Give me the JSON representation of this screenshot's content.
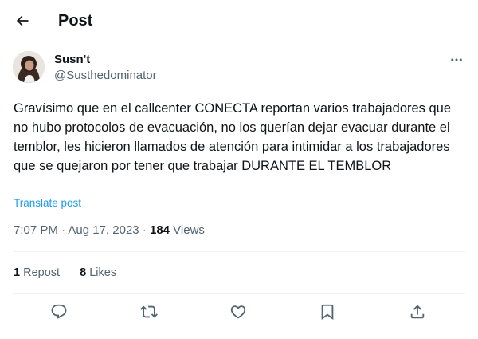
{
  "header": {
    "title": "Post",
    "back_icon": "arrow-left-icon"
  },
  "author": {
    "display_name": "Susn't",
    "handle": "@Susthedominator"
  },
  "menu": {
    "icon": "more-horizontal-icon"
  },
  "post": {
    "text": "Gravísimo que en el callcenter CONECTA reportan varios trabajadores que no hubo protocolos de evacuación, no los querían dejar evacuar durante el temblor, les hicieron llamados de atención para intimidar a los trabajadores que se quejaron por tener que trabajar DURANTE EL TEMBLOR",
    "translate_label": "Translate post"
  },
  "meta": {
    "time": "7:07 PM",
    "separator": " · ",
    "date": "Aug 17, 2023",
    "views_count": "184",
    "views_label": " Views"
  },
  "stats": {
    "reposts_count": "1",
    "reposts_label": " Repost",
    "likes_count": "8",
    "likes_label": " Likes"
  },
  "actions": [
    {
      "name": "reply",
      "icon": "reply-icon"
    },
    {
      "name": "repost",
      "icon": "repost-icon"
    },
    {
      "name": "like",
      "icon": "heart-icon"
    },
    {
      "name": "bookmark",
      "icon": "bookmark-icon"
    },
    {
      "name": "share",
      "icon": "share-icon"
    }
  ],
  "colors": {
    "accent": "#1d9bf0",
    "text": "#0f1419",
    "secondary": "#536471",
    "divider": "#eff3f4"
  }
}
